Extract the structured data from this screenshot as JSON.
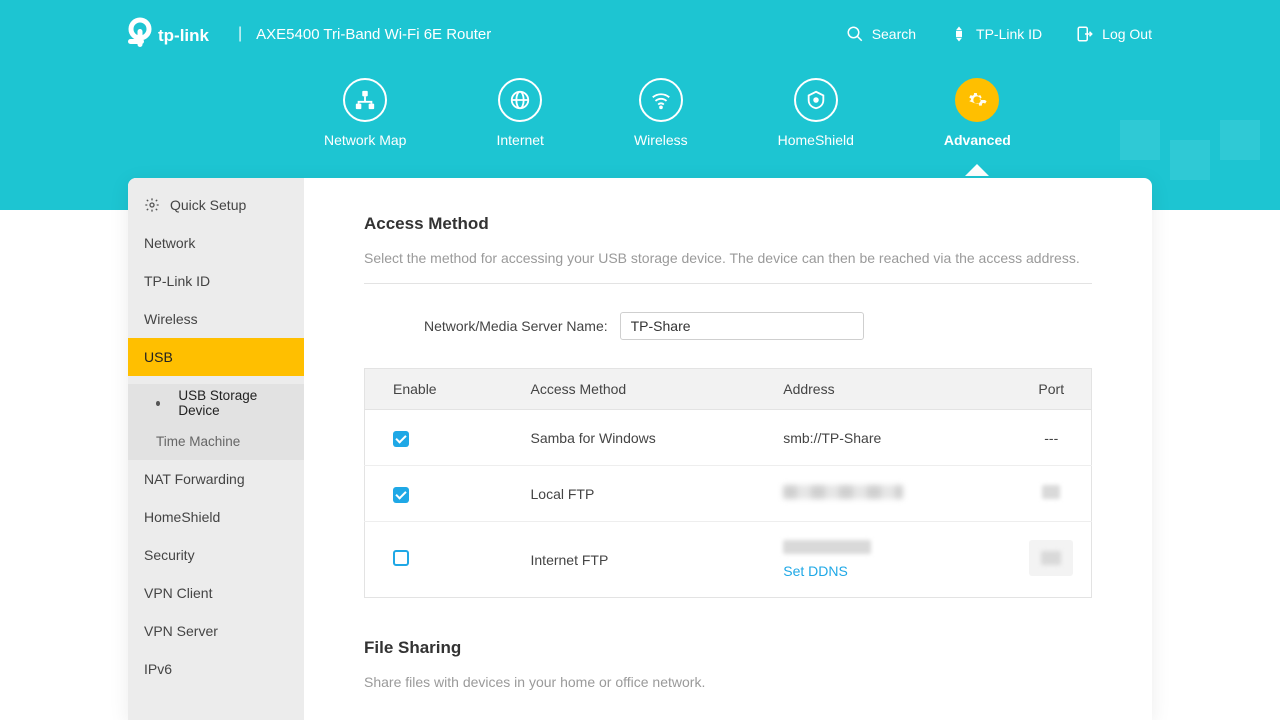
{
  "header": {
    "product": "AXE5400 Tri-Band Wi-Fi 6E Router",
    "search": "Search",
    "tplink_id": "TP-Link ID",
    "logout": "Log Out"
  },
  "nav": {
    "network_map": "Network Map",
    "internet": "Internet",
    "wireless": "Wireless",
    "homeshield": "HomeShield",
    "advanced": "Advanced"
  },
  "sidebar": {
    "quick_setup": "Quick Setup",
    "network": "Network",
    "tplink_id": "TP-Link ID",
    "wireless": "Wireless",
    "usb": "USB",
    "usb_storage": "USB Storage Device",
    "time_machine": "Time Machine",
    "nat": "NAT Forwarding",
    "homeshield": "HomeShield",
    "security": "Security",
    "vpn_client": "VPN Client",
    "vpn_server": "VPN Server",
    "ipv6": "IPv6"
  },
  "content": {
    "access_method_title": "Access Method",
    "access_method_desc": "Select the method for accessing your USB storage device. The device can then be reached via the access address.",
    "server_name_label": "Network/Media Server Name:",
    "server_name_value": "TP-Share",
    "table": {
      "cols": {
        "enable": "Enable",
        "method": "Access Method",
        "address": "Address",
        "port": "Port"
      },
      "rows": [
        {
          "enabled": true,
          "method": "Samba for Windows",
          "address": "smb://TP-Share",
          "port": "---"
        },
        {
          "enabled": true,
          "method": "Local FTP"
        },
        {
          "enabled": false,
          "method": "Internet FTP",
          "link": "Set DDNS"
        }
      ]
    },
    "file_sharing_title": "File Sharing",
    "file_sharing_desc": "Share files with devices in your home or office network."
  }
}
